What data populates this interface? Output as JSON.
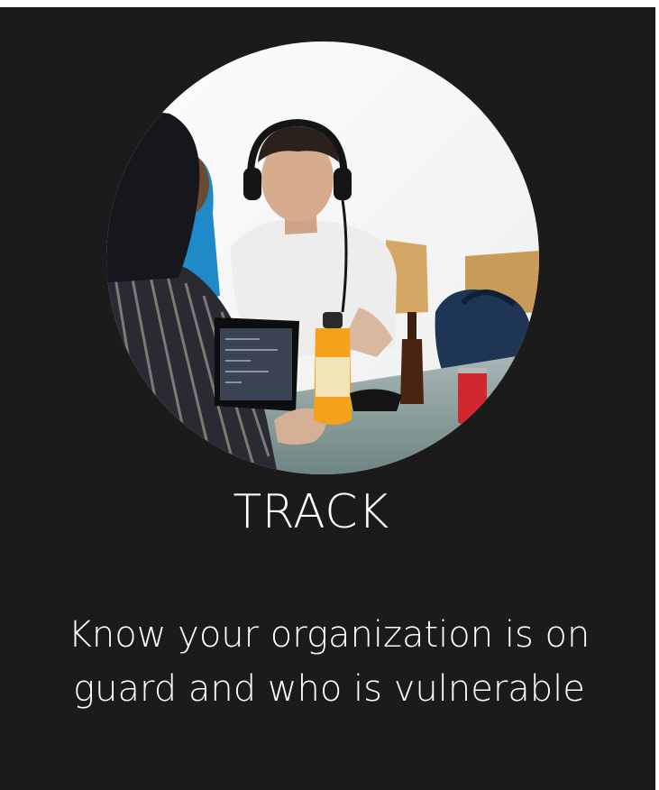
{
  "card": {
    "title": "TRACK",
    "description_lines": [
      "Know your organization is on",
      "guard and who is vulnerable"
    ]
  },
  "photo": {
    "icon": "photo-people-at-table"
  }
}
